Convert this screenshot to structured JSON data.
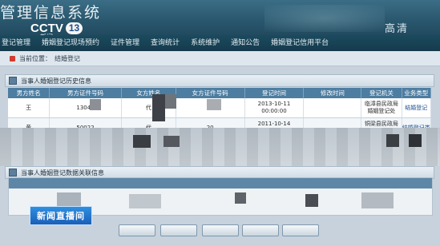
{
  "title_bar": {
    "app_title": "管理信息系统",
    "channel_logo": "CCTV",
    "channel_number": "13",
    "channel_sub": "新闻",
    "hd_badge": "高清"
  },
  "nav": {
    "items": [
      "登记管理",
      "婚姻登记现场预约",
      "证件管理",
      "查询统计",
      "系统维护",
      "通知公告",
      "婚姻登记信用平台"
    ]
  },
  "breadcrumb": {
    "prefix": "当前位置：",
    "current": "结婚登记"
  },
  "history_section": {
    "title": "当事人婚姻登记历史信息",
    "columns": [
      "男方姓名",
      "男方证件号码",
      "女方姓名",
      "女方证件号码",
      "登记时间",
      "修改时间",
      "登记机关",
      "业务类型"
    ],
    "rows": [
      [
        "王",
        "13042",
        "代",
        "07",
        "2013-10-11\n00:00:00",
        "",
        "临漳县民政局\n婚姻登记处",
        "结婚登记"
      ],
      [
        "黄",
        "50022",
        "代",
        "20",
        "2011-10-14\n00:00:00",
        "",
        "铜梁县民政局\n婚姻登记处",
        "结婚登记类"
      ]
    ]
  },
  "related_section": {
    "title": "当事人婚姻登记数据关联信息"
  },
  "buttons": [
    "",
    "",
    "",
    "",
    ""
  ],
  "overlay": {
    "news_label": "新闻直播间"
  },
  "colors": {
    "title_bar": "#2a586f",
    "nav_bar": "#153b4d",
    "table_header": "#4d7da1",
    "news_badge": "#1a5fb8"
  }
}
